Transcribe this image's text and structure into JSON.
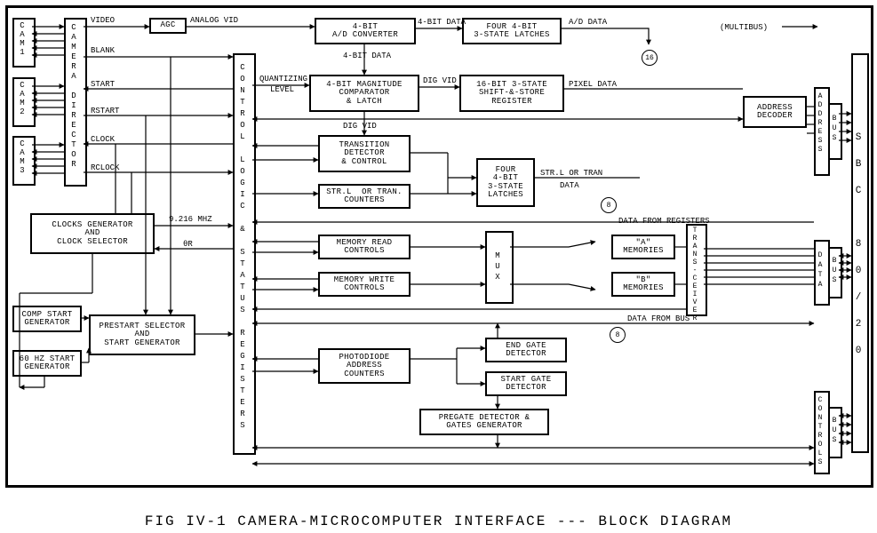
{
  "caption": "FIG IV-1   CAMERA-MICROCOMPUTER  INTERFACE  ---  BLOCK DIAGRAM",
  "multibus": "(MULTIBUS)",
  "cams": {
    "c1": "C\nA\nM\n1",
    "c2": "C\nA\nM\n2",
    "c3": "C\nA\nM\n3"
  },
  "camera_director": "C\nA\nM\nE\nR\nA\n\nD\nI\nR\nE\nC\nT\nO\nR",
  "control_logic": "C\nO\nN\nT\nR\nO\nL\n\nL\nO\nG\nI\nC\n\n&\n\nS\nT\nA\nT\nU\nS\n\nR\nE\nG\nI\nS\nT\nE\nR\nS",
  "sbc": "S\nB\nC\n\n8\n0\n/\n2\n0",
  "trans": "T\nR\nA\nN\nS\n-\nC\nE\nI\nV\nE\nR",
  "addr_vert": "A\nD\nD\nR\nE\nS\nS",
  "data_vert": "D\nA\nT\nA",
  "ctrl_vert": "C\nO\nN\nT\nR\nO\nL\nS",
  "bus_vert": "B\nU\nS",
  "mux": "M\nU\nX",
  "signals": {
    "video": "VIDEO",
    "blank": "BLANK",
    "start": "START",
    "rstart": "RSTART",
    "clock": "CLOCK",
    "rclock": "RCLOCK",
    "analogvid": "ANALOG VID",
    "fourbitdata": "4-BIT DATA",
    "fourbitdata2": "4-BIT DATA",
    "digvid": "DIG VID",
    "digvid2": "DIG VID",
    "addata": "A/D DATA",
    "pixeldata": "PIXEL DATA",
    "quantizing": "QUANTIZING",
    "level": "LEVEL",
    "nine_mhz": "9.216 MHZ",
    "theta": "θR",
    "strl_or_tran": "STR.L OR TRAN",
    "data": "DATA",
    "data_from_reg": "DATA FROM REGISTERS",
    "data_from_bus": "DATA FROM BUS",
    "n16": "16",
    "n8": "8"
  },
  "boxes": {
    "agc": "AGC",
    "adc": "4-BIT\nA/D CONVERTER",
    "four_latches": "FOUR 4-BIT\n3-STATE LATCHES",
    "comparator": "4-BIT MAGNITUDE\nCOMPARATOR\n& LATCH",
    "shift_store": "16-BIT 3-STATE\nSHIFT-&-STORE\nREGISTER",
    "addr_dec": "ADDRESS\nDECODER",
    "transition": "TRANSITION\nDETECTOR\n& CONTROL",
    "four_4bit_latches": "FOUR\n4-BIT\n3-STATE\nLATCHES",
    "strl_counters": "STR.L  OR TRAN.\nCOUNTERS",
    "mem_read": "MEMORY READ\nCONTROLS",
    "mem_write": "MEMORY WRITE\nCONTROLS",
    "a_mem": "\"A\"\nMEMORIES",
    "b_mem": "\"B\"\nMEMORIES",
    "clocks": "CLOCKS GENERATOR\nAND\nCLOCK SELECTOR",
    "comp_start": "COMP START\nGENERATOR",
    "sixty_hz": "60 HZ START\nGENERATOR",
    "prestart": "PRESTART SELECTOR\nAND\nSTART GENERATOR",
    "photodiode": "PHOTODIODE\nADDRESS\nCOUNTERS",
    "end_gate": "END GATE\nDETECTOR",
    "start_gate": "START GATE\nDETECTOR",
    "pregate": "PREGATE DETECTOR &\nGATES GENERATOR"
  }
}
